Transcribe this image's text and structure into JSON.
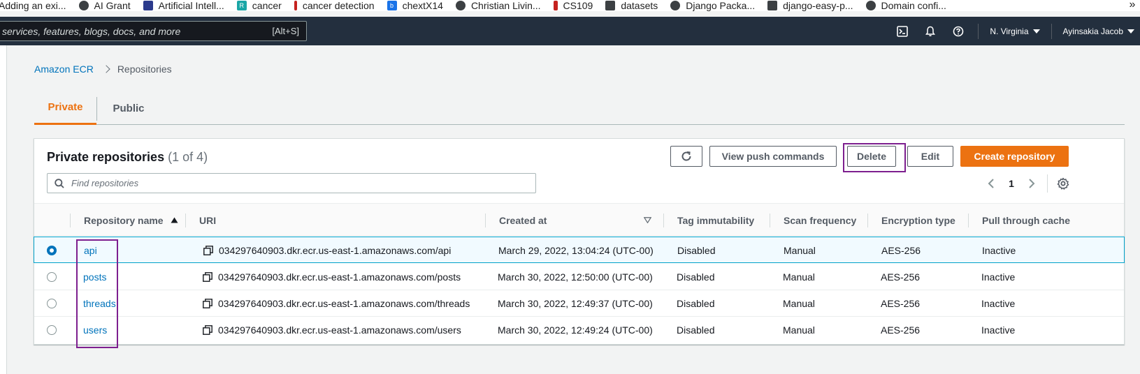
{
  "bookmarks": [
    {
      "label": "Adding an exi...",
      "icon": "bookmark-page-icon"
    },
    {
      "label": "AI Grant",
      "icon": "globe-icon"
    },
    {
      "label": "Artificial Intell...",
      "icon": "university-shield-icon"
    },
    {
      "label": "cancer",
      "icon": "r-logo-icon"
    },
    {
      "label": "cancer detection",
      "icon": "bookmark-page-icon"
    },
    {
      "label": "chextX14",
      "icon": "box-logo-icon"
    },
    {
      "label": "Christian Livin...",
      "icon": "globe-icon"
    },
    {
      "label": "CS109",
      "icon": "stanford-logo-icon"
    },
    {
      "label": "datasets",
      "icon": "bookmark-page-icon"
    },
    {
      "label": "Django Packa...",
      "icon": "globe-icon"
    },
    {
      "label": "django-easy-p...",
      "icon": "bookmark-page-icon"
    },
    {
      "label": "Domain confi...",
      "icon": "github-icon"
    }
  ],
  "bookmarks_more": "»",
  "topnav": {
    "search_placeholder": "services, features, blogs, docs, and more",
    "search_shortcut": "[Alt+S]",
    "region": "N. Virginia",
    "account": "Ayinsakia Jacob"
  },
  "breadcrumb": {
    "root": "Amazon ECR",
    "current": "Repositories"
  },
  "tabs": {
    "private": "Private",
    "public": "Public"
  },
  "panel": {
    "title": "Private repositories",
    "count": "(1 of 4)",
    "buttons": {
      "view_push": "View push commands",
      "delete": "Delete",
      "edit": "Edit",
      "create": "Create repository"
    },
    "find_placeholder": "Find repositories",
    "page_number": "1"
  },
  "table": {
    "columns": {
      "name": "Repository name",
      "uri": "URI",
      "created": "Created at",
      "tag": "Tag immutability",
      "scan": "Scan frequency",
      "enc": "Encryption type",
      "pull": "Pull through cache"
    },
    "rows": [
      {
        "name": "api",
        "uri": "034297640903.dkr.ecr.us-east-1.amazonaws.com/api",
        "created": "March 29, 2022, 13:04:24 (UTC-00)",
        "tag": "Disabled",
        "scan": "Manual",
        "enc": "AES-256",
        "pull": "Inactive",
        "selected": true
      },
      {
        "name": "posts",
        "uri": "034297640903.dkr.ecr.us-east-1.amazonaws.com/posts",
        "created": "March 30, 2022, 12:50:00 (UTC-00)",
        "tag": "Disabled",
        "scan": "Manual",
        "enc": "AES-256",
        "pull": "Inactive",
        "selected": false
      },
      {
        "name": "threads",
        "uri": "034297640903.dkr.ecr.us-east-1.amazonaws.com/threads",
        "created": "March 30, 2022, 12:49:37 (UTC-00)",
        "tag": "Disabled",
        "scan": "Manual",
        "enc": "AES-256",
        "pull": "Inactive",
        "selected": false
      },
      {
        "name": "users",
        "uri": "034297640903.dkr.ecr.us-east-1.amazonaws.com/users",
        "created": "March 30, 2022, 12:49:24 (UTC-00)",
        "tag": "Disabled",
        "scan": "Manual",
        "enc": "AES-256",
        "pull": "Inactive",
        "selected": false
      }
    ]
  },
  "colors": {
    "accent_orange": "#ec7211",
    "link_blue": "#0073bb",
    "nav_dark": "#232f3e",
    "annotation_purple": "#7d1f8f"
  }
}
